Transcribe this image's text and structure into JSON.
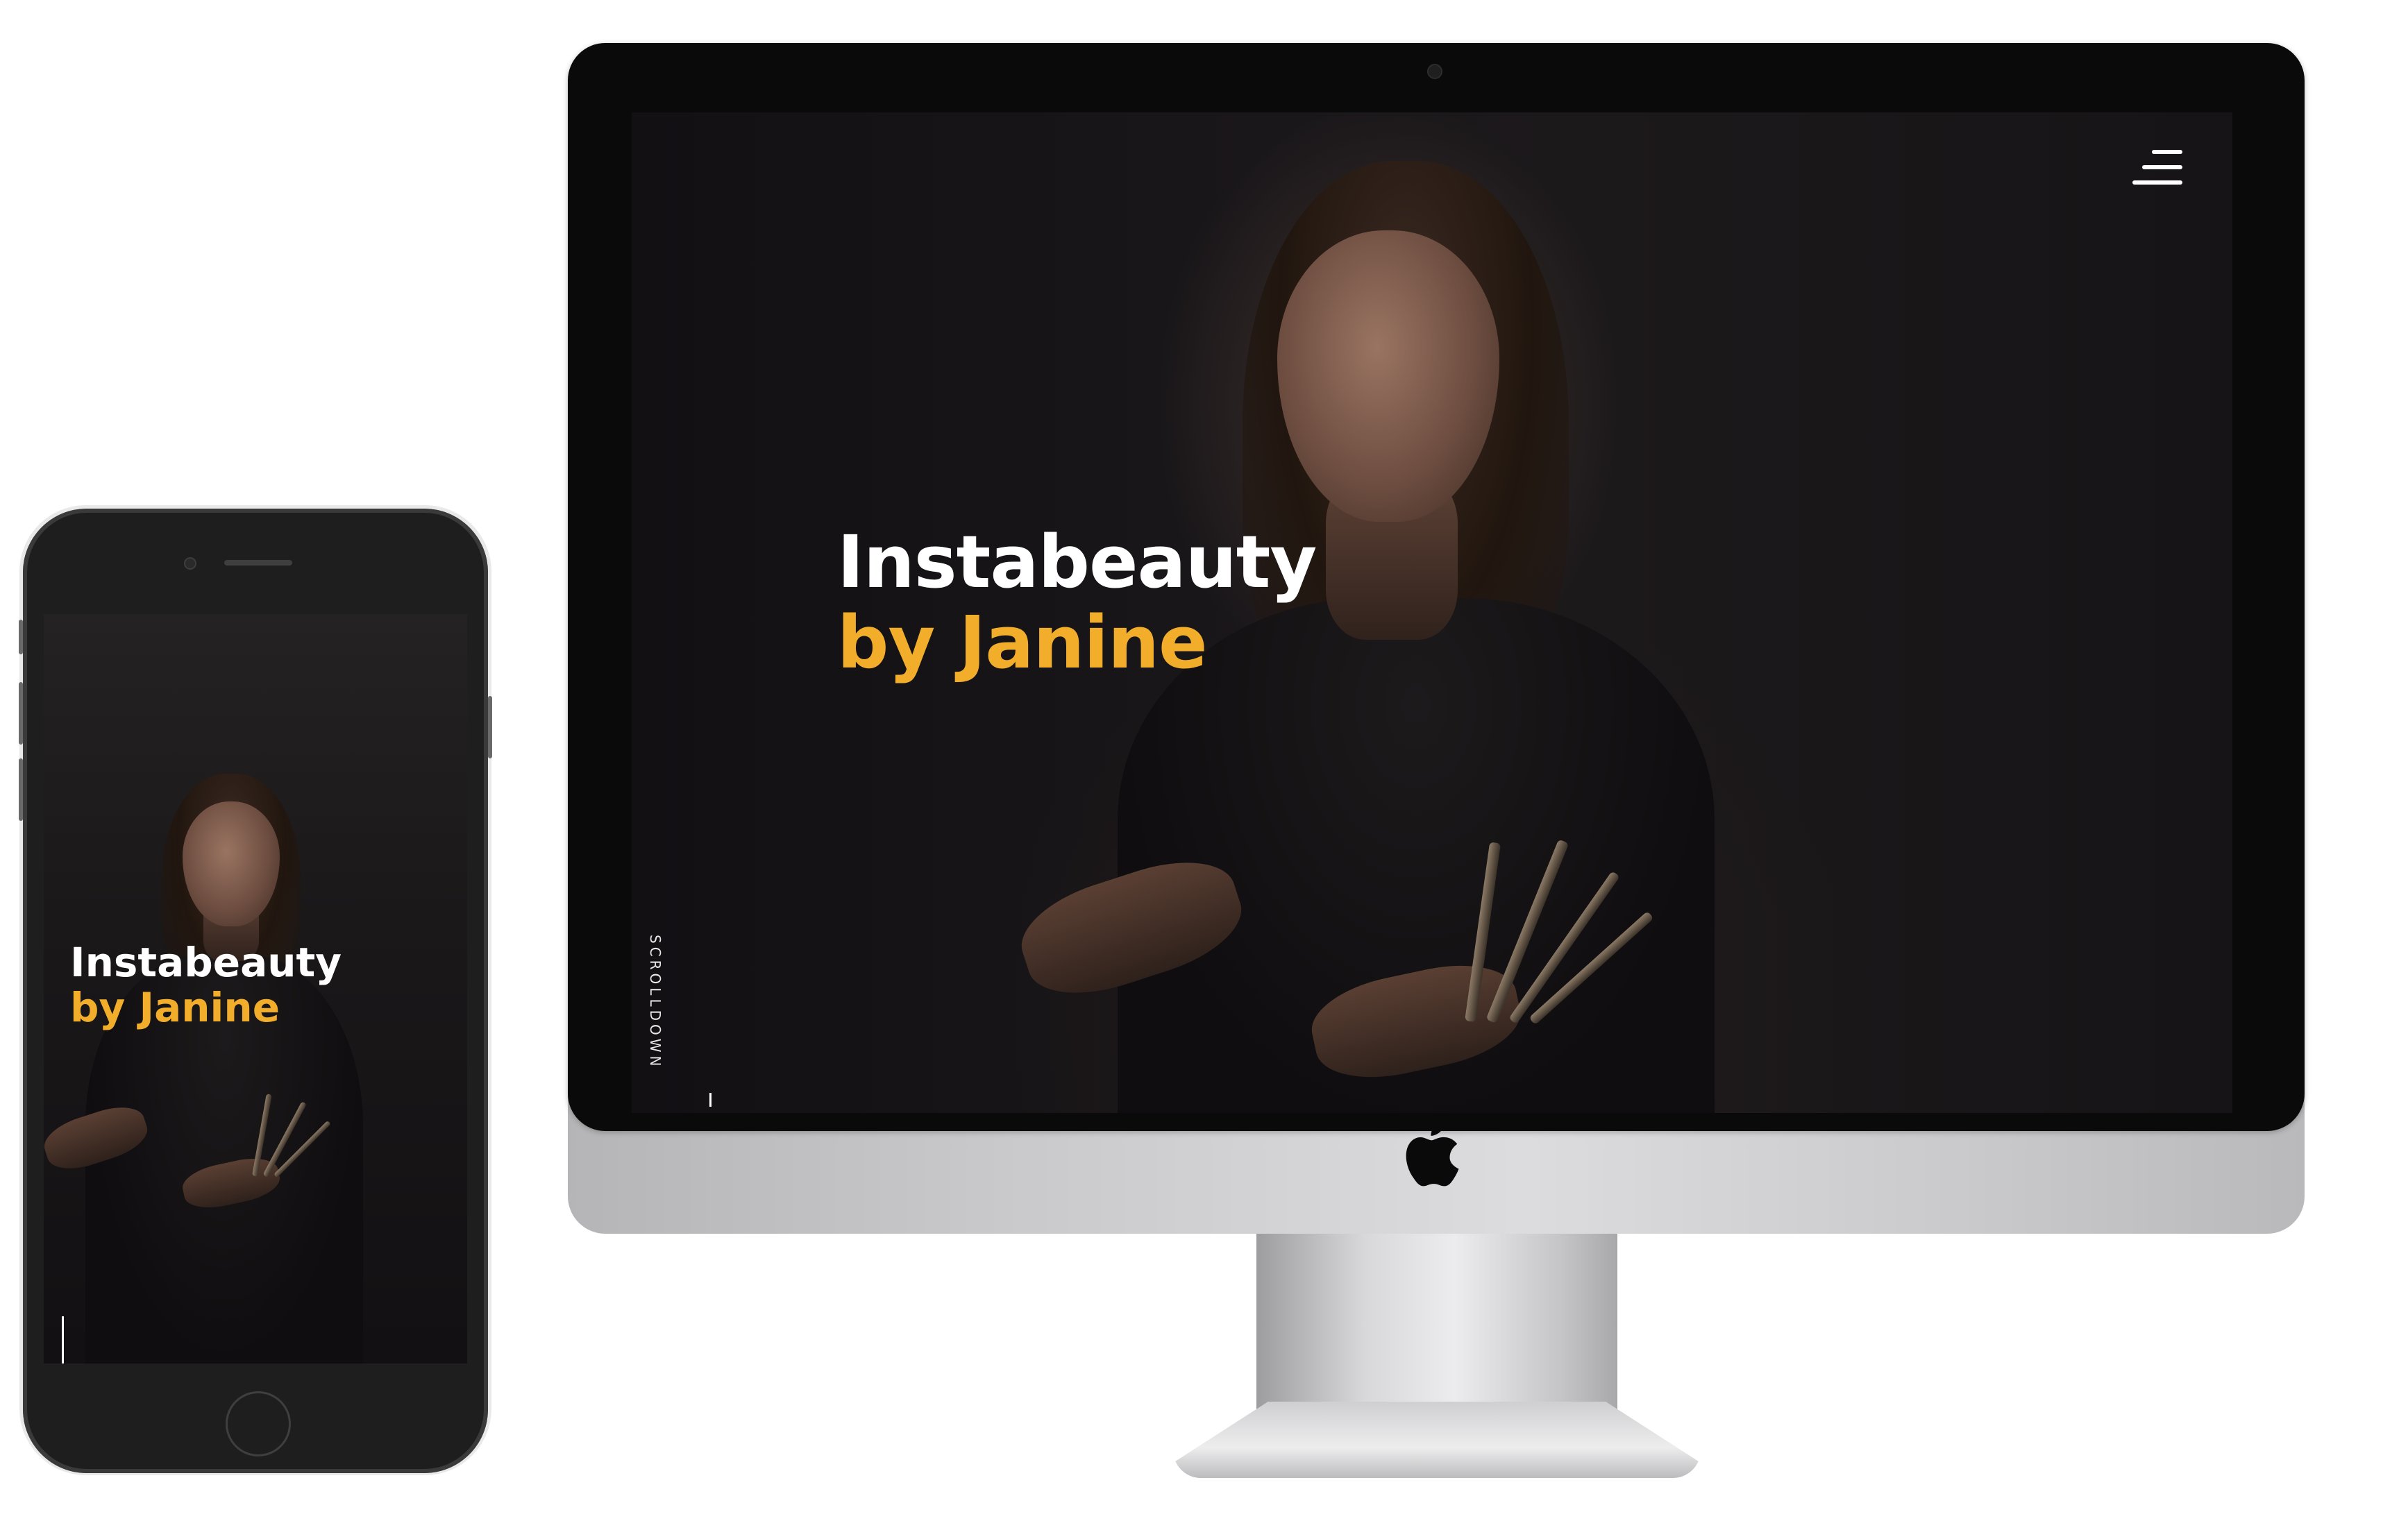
{
  "hero": {
    "title_line1": "Instabeauty",
    "title_line2": "by Janine"
  },
  "scroll_indicator": {
    "label": "SCROLLDOWN"
  },
  "colors": {
    "accent": "#f2ae2b",
    "background": "#141214",
    "text": "#ffffff"
  },
  "icons": {
    "menu": "menu-icon",
    "brand": "apple-logo-icon"
  }
}
